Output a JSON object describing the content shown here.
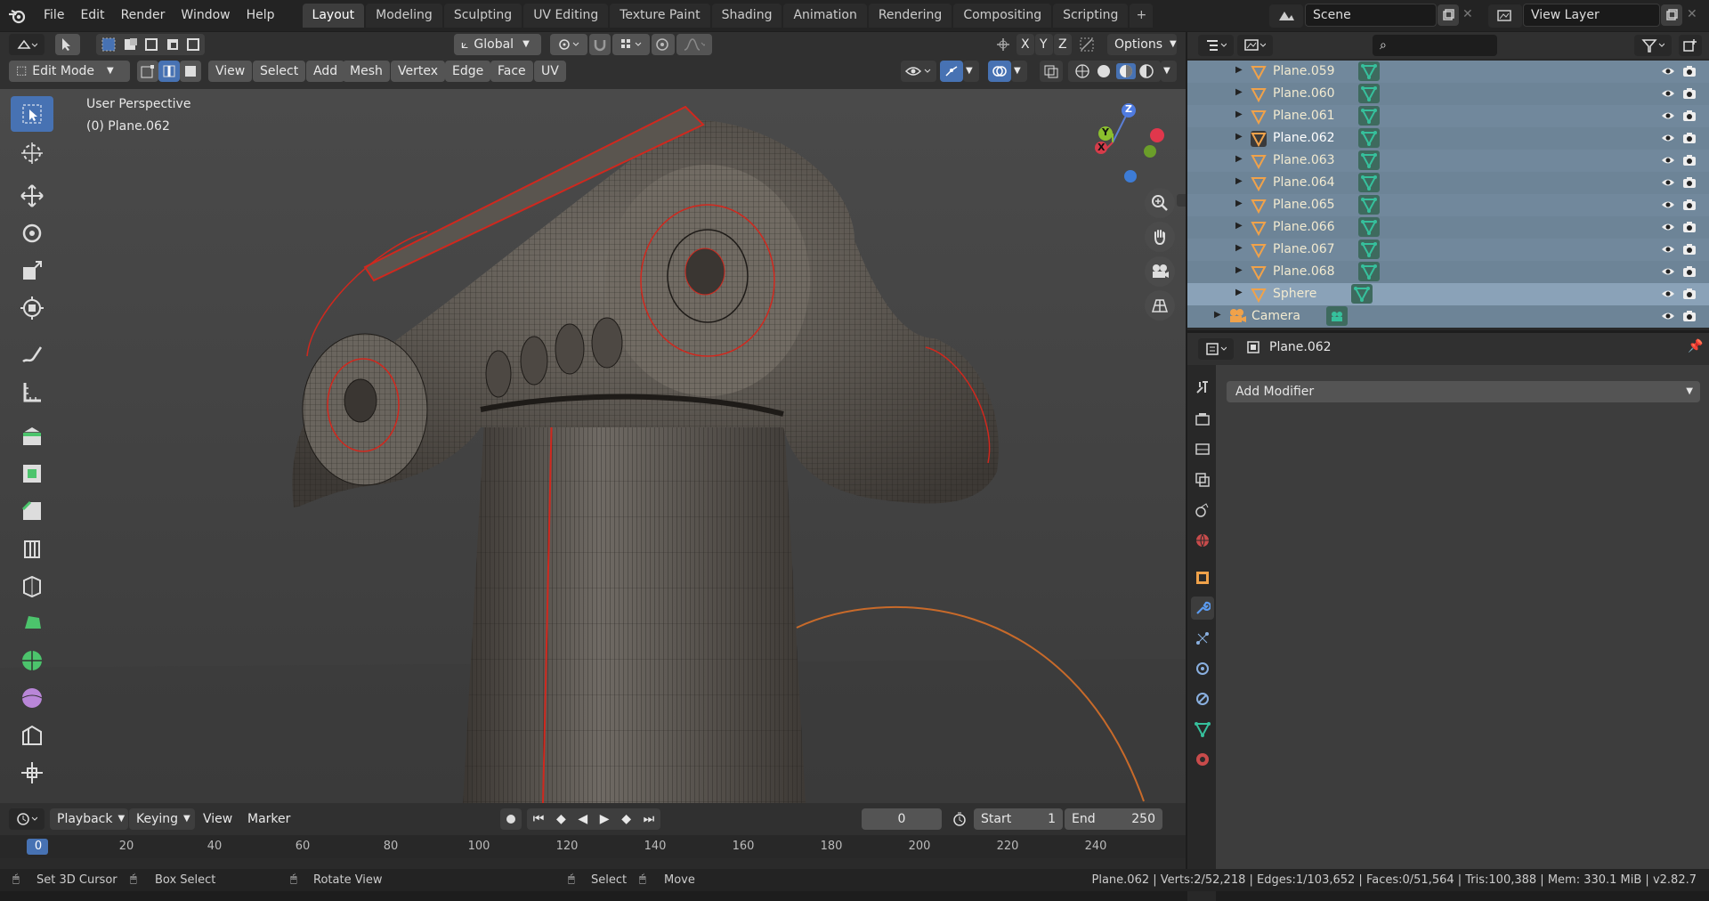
{
  "topbar": {
    "menus": [
      "File",
      "Edit",
      "Render",
      "Window",
      "Help"
    ],
    "workspaces": [
      "Layout",
      "Modeling",
      "Sculpting",
      "UV Editing",
      "Texture Paint",
      "Shading",
      "Animation",
      "Rendering",
      "Compositing",
      "Scripting"
    ],
    "active_workspace": "Layout",
    "plus": "+",
    "scene": "Scene",
    "view_layer": "View Layer"
  },
  "viewport_header": {
    "orientation": "Global",
    "axes": [
      "X",
      "Y",
      "Z"
    ],
    "options": "Options",
    "mode": "Edit Mode",
    "menus": [
      "View",
      "Select",
      "Add",
      "Mesh",
      "Vertex",
      "Edge",
      "Face",
      "UV"
    ]
  },
  "viewport": {
    "perspective": "User Perspective",
    "object": "(0) Plane.062",
    "gizmo": {
      "z": "Z",
      "y": "Y",
      "x": "X"
    }
  },
  "timeline": {
    "menus": [
      "Playback",
      "Keying",
      "View",
      "Marker"
    ],
    "current_frame": "0",
    "start_label": "Start",
    "start": "1",
    "end_label": "End",
    "end": "250",
    "ruler": [
      "0",
      "20",
      "40",
      "60",
      "80",
      "100",
      "120",
      "140",
      "160",
      "180",
      "200",
      "220",
      "240"
    ]
  },
  "statusbar": {
    "items": [
      "Set 3D Cursor",
      "Box Select",
      "Rotate View",
      "Select",
      "Move"
    ],
    "stats": "Plane.062 | Verts:2/52,218 | Edges:1/103,652 | Faces:0/51,564 | Tris:100,388 | Mem: 330.1 MiB | v2.82.7"
  },
  "outliner": {
    "rows": [
      {
        "name": "Plane.059"
      },
      {
        "name": "Plane.060"
      },
      {
        "name": "Plane.061"
      },
      {
        "name": "Plane.062"
      },
      {
        "name": "Plane.063"
      },
      {
        "name": "Plane.064"
      },
      {
        "name": "Plane.065"
      },
      {
        "name": "Plane.066"
      },
      {
        "name": "Plane.067"
      },
      {
        "name": "Plane.068"
      },
      {
        "name": "Sphere"
      },
      {
        "name": "Camera"
      }
    ]
  },
  "properties": {
    "object": "Plane.062",
    "add_modifier": "Add Modifier"
  },
  "colors": {
    "accent": "#4772b3",
    "outliner_row": "#71889c",
    "object_icon": "#f0a24a",
    "mesh_data_icon": "#36c09c",
    "wire_red": "#d0281e"
  }
}
